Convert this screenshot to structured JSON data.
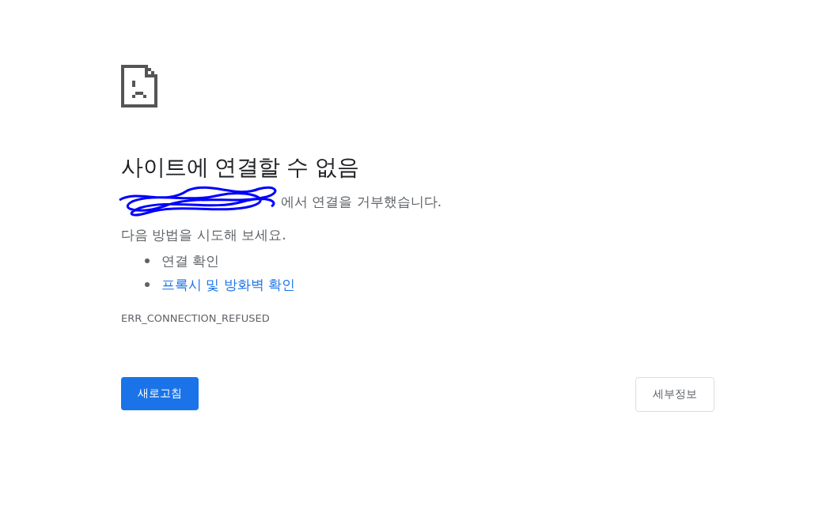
{
  "heading": "사이트에 연결할 수 없음",
  "message": {
    "host_redacted": true,
    "text": "에서 연결을 거부했습니다."
  },
  "suggestions_intro": "다음 방법을 시도해 보세요.",
  "suggestions": [
    {
      "text": "연결 확인",
      "kind": "text"
    },
    {
      "text": "프록시 및 방화벽 확인",
      "kind": "link"
    }
  ],
  "error_code": "ERR_CONNECTION_REFUSED",
  "buttons": {
    "reload": "새로고침",
    "details": "세부정보"
  }
}
